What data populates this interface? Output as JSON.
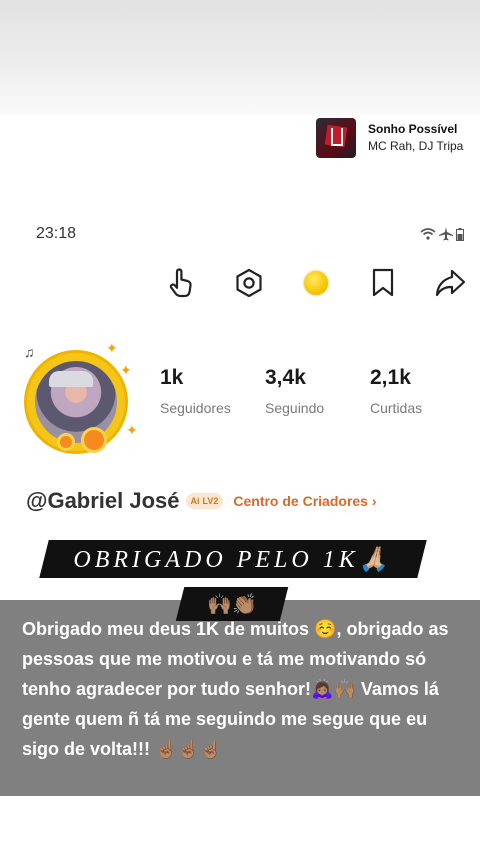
{
  "music": {
    "title": "Sonho Possível",
    "artist": "MC Rah, DJ Tripa"
  },
  "status_bar": {
    "time": "23:18"
  },
  "toolbar": {
    "icons": [
      "hand-point-icon",
      "settings-hexagon-icon",
      "coin-icon",
      "bookmark-icon",
      "share-icon"
    ]
  },
  "profile": {
    "followers_value": "1k",
    "followers_label": "Seguidores",
    "following_value": "3,4k",
    "following_label": "Seguindo",
    "likes_value": "2,1k",
    "likes_label": "Curtidas",
    "username": "@Gabriel José",
    "level_badge": "LV2",
    "level_prefix": "Ai",
    "creator_link": "Centro de Criadores ›"
  },
  "overlay": {
    "banner": "OBRIGADO PELO 1K🙏🏼",
    "emoji_banner": "🙌🏽👏🏽",
    "caption": "Obrigado meu deus 1K de muitos ☺️, obrigado as pessoas que me motivou e tá me motivando só tenho agradecer por tudo senhor!🙇🏽‍♀️🙌🏽 Vamos lá gente quem ñ tá me seguindo me segue que eu sigo de volta!!! ☝🏽☝🏽☝🏽"
  },
  "colors": {
    "accent": "#d9692a",
    "coin": "#f6c700",
    "caption_bg": "#6e6e6e"
  }
}
